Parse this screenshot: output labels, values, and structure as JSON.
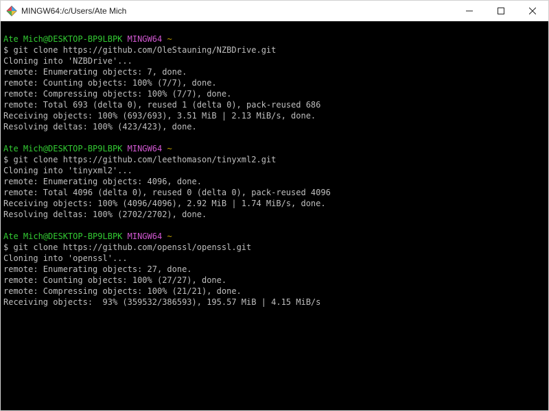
{
  "window": {
    "title": "MINGW64:/c/Users/Ate Mich"
  },
  "prompt": {
    "user_host": "Ate Mich@DESKTOP-BP9LBPK",
    "env": "MINGW64",
    "cwd_symbol": "~",
    "dollar": "$"
  },
  "blocks": [
    {
      "command": "git clone https://github.com/OleStauning/NZBDrive.git",
      "output": [
        "Cloning into 'NZBDrive'...",
        "remote: Enumerating objects: 7, done.",
        "remote: Counting objects: 100% (7/7), done.",
        "remote: Compressing objects: 100% (7/7), done.",
        "remote: Total 693 (delta 0), reused 1 (delta 0), pack-reused 686",
        "Receiving objects: 100% (693/693), 3.51 MiB | 2.13 MiB/s, done.",
        "Resolving deltas: 100% (423/423), done."
      ]
    },
    {
      "command": "git clone https://github.com/leethomason/tinyxml2.git",
      "output": [
        "Cloning into 'tinyxml2'...",
        "remote: Enumerating objects: 4096, done.",
        "remote: Total 4096 (delta 0), reused 0 (delta 0), pack-reused 4096",
        "Receiving objects: 100% (4096/4096), 2.92 MiB | 1.74 MiB/s, done.",
        "Resolving deltas: 100% (2702/2702), done."
      ]
    },
    {
      "command": "git clone https://github.com/openssl/openssl.git",
      "output": [
        "Cloning into 'openssl'...",
        "remote: Enumerating objects: 27, done.",
        "remote: Counting objects: 100% (27/27), done.",
        "remote: Compressing objects: 100% (21/21), done.",
        "Receiving objects:  93% (359532/386593), 195.57 MiB | 4.15 MiB/s"
      ]
    }
  ]
}
